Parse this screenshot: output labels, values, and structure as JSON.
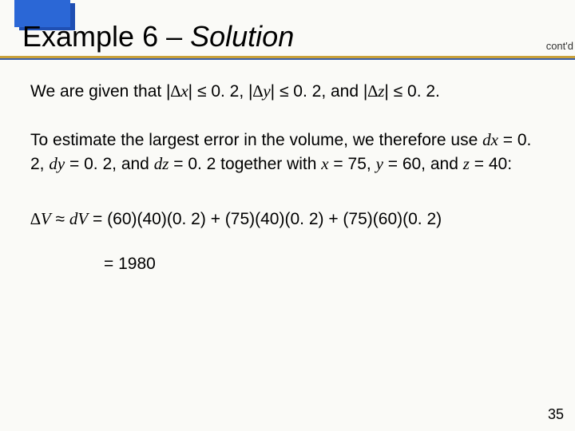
{
  "header": {
    "title_prefix": "Example 6 – ",
    "title_italic": "Solution",
    "contd": "cont'd"
  },
  "body": {
    "p1_a": "We are given that |",
    "p1_dx": "∆x",
    "p1_b": "| ≤ 0. 2, |",
    "p1_dy": "∆y",
    "p1_c": "| ≤ 0. 2, and |",
    "p1_dz": "∆z",
    "p1_d": "| ≤ 0. 2.",
    "p2_a": "To estimate the largest error in the volume, we therefore use ",
    "p2_dx": "dx",
    "p2_b": " = 0. 2, ",
    "p2_dy": "dy",
    "p2_c": " = 0. 2, and ",
    "p2_dz": "dz",
    "p2_d": " = 0. 2 together with ",
    "p2_x": "x",
    "p2_e": " = 75, ",
    "p2_y": "y",
    "p2_f": " = 60, and ",
    "p2_z": "z",
    "p2_g": " = 40:",
    "eq_dV1": "∆V",
    "eq_approx": " ≈ ",
    "eq_dV2": "dV",
    "eq_rhs": " = (60)(40)(0. 2) + (75)(40)(0. 2) + (75)(60)(0. 2)",
    "eq_result": "= 1980"
  },
  "slide_number": "35",
  "chart_data": {
    "type": "table",
    "title": "Differential error estimate for box volume",
    "variables": [
      {
        "name": "x",
        "value": 75,
        "max_error": 0.2
      },
      {
        "name": "y",
        "value": 60,
        "max_error": 0.2
      },
      {
        "name": "z",
        "value": 40,
        "max_error": 0.2
      }
    ],
    "dV_terms": [
      {
        "expr": "(60)(40)(0.2)"
      },
      {
        "expr": "(75)(40)(0.2)"
      },
      {
        "expr": "(75)(60)(0.2)"
      }
    ],
    "dV_total": 1980
  }
}
